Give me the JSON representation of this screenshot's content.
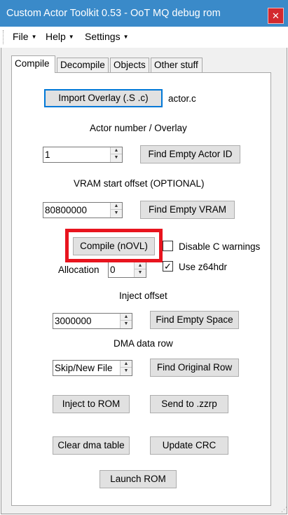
{
  "window": {
    "title": "Custom Actor Toolkit 0.53 - OoT MQ debug rom",
    "close_glyph": "✕"
  },
  "menu": [
    {
      "label": "File"
    },
    {
      "label": "Help"
    },
    {
      "label": "Settings"
    }
  ],
  "tabs": [
    {
      "label": "Compile",
      "active": true
    },
    {
      "label": "Decompile"
    },
    {
      "label": "Objects"
    },
    {
      "label": "Other stuff"
    }
  ],
  "compile": {
    "import_overlay_label": "Import Overlay (.S .c)",
    "overlay_filename": "actor.c",
    "actor_number_heading": "Actor number / Overlay",
    "actor_number_value": "1",
    "find_empty_actor_label": "Find Empty Actor ID",
    "vram_heading": "VRAM start offset (OPTIONAL)",
    "vram_value": "80800000",
    "find_empty_vram_label": "Find Empty VRAM",
    "compile_label": "Compile (nOVL)",
    "disable_c_warnings_label": "Disable C warnings",
    "disable_c_warnings_checked": false,
    "use_z64hdr_label": "Use z64hdr",
    "use_z64hdr_checked": true,
    "allocation_label": "Allocation",
    "allocation_value": "0",
    "inject_offset_heading": "Inject offset",
    "inject_offset_value": "3000000",
    "find_empty_space_label": "Find Empty Space",
    "dma_heading": "DMA data row",
    "dma_value": "Skip/New File",
    "find_original_row_label": "Find Original Row",
    "inject_rom_label": "Inject to ROM",
    "send_zzrp_label": "Send to .zzrp",
    "clear_dma_label": "Clear dma table",
    "update_crc_label": "Update CRC",
    "launch_rom_label": "Launch ROM"
  },
  "glyphs": {
    "spin_up": "▲",
    "spin_down": "▼",
    "menu_arrow": "▼",
    "check_mark": "✓",
    "grip": "⋰"
  },
  "colors": {
    "titlebar": "#3a8ac9",
    "close_button": "#d3292e",
    "default_button_border": "#0078d7",
    "highlight_box": "#e8141e"
  }
}
